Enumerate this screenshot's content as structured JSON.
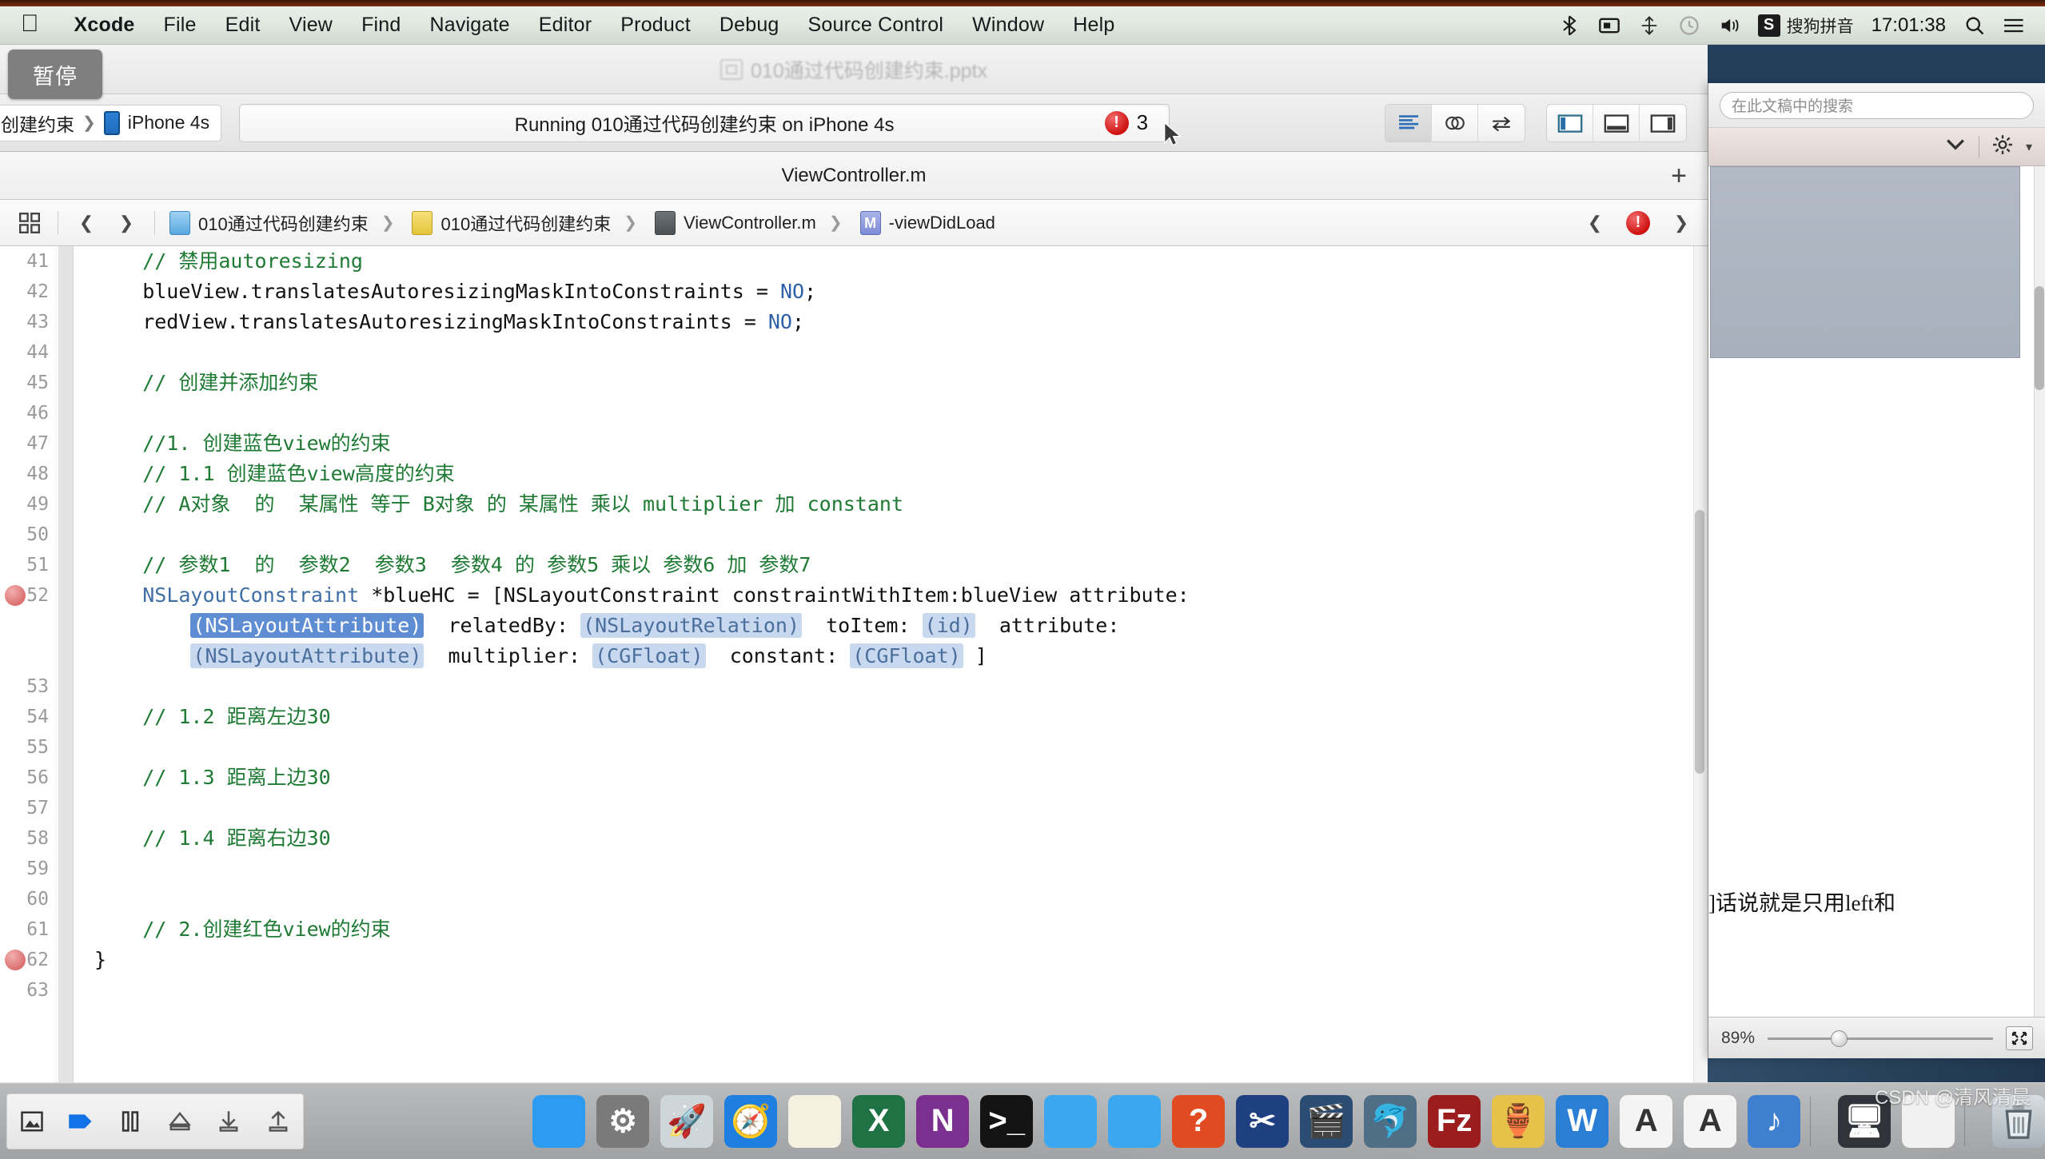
{
  "menubar": {
    "apple_icon": "apple-logo",
    "items": [
      "Xcode",
      "File",
      "Edit",
      "View",
      "Find",
      "Navigate",
      "Editor",
      "Product",
      "Debug",
      "Source Control",
      "Window",
      "Help"
    ],
    "status_icons": [
      "bluetooth-icon",
      "screen-record-icon",
      "airplay-icon",
      "timemachine-icon",
      "volume-icon"
    ],
    "ime_badge": "S",
    "ime_label": "搜狗拼音",
    "clock": "17:01:38",
    "search_icon": "search-icon",
    "notification_icon": "notification-center-icon"
  },
  "tooltip": {
    "label": "暂停"
  },
  "xcode": {
    "window_title": "010通过代码创建约束.pptx",
    "toolbar": {
      "scheme_project": "创建约束",
      "scheme_device": "iPhone 4s",
      "status_text": "Running 010通过代码创建约束 on iPhone 4s",
      "issue_count": "3",
      "issue_icon": "error-stop-icon",
      "editor_buttons": [
        "standard-editor-icon",
        "assistant-editor-icon",
        "version-editor-icon"
      ],
      "view_buttons": [
        "toggle-navigator-icon",
        "toggle-debug-area-icon",
        "toggle-utilities-icon"
      ]
    },
    "tab_title": "ViewController.m",
    "add_tab_icon": "plus-icon",
    "jumpbar": {
      "related_files_icon": "related-files-icon",
      "back_icon": "chevron-left-icon",
      "forward_icon": "chevron-right-icon",
      "crumbs": [
        {
          "icon": "project-icon",
          "label": "010通过代码创建约束"
        },
        {
          "icon": "folder-icon",
          "label": "010通过代码创建约束"
        },
        {
          "icon": "source-file-icon",
          "label": "ViewController.m"
        },
        {
          "icon": "method-icon",
          "label": "-viewDidLoad"
        }
      ],
      "prev_issue_icon": "chevron-left-icon",
      "issue_icon": "error-stop-icon",
      "next_issue_icon": "chevron-right-icon"
    },
    "code": {
      "first_line_number": 41,
      "breakpoint_lines": [
        52,
        62
      ],
      "lines": [
        {
          "n": 41,
          "tokens": [
            {
              "t": "    // 禁用autoresizing",
              "c": "cmt"
            }
          ]
        },
        {
          "n": 42,
          "tokens": [
            {
              "t": "    blueView.translatesAutoresizingMaskIntoConstraints = ",
              "c": ""
            },
            {
              "t": "NO",
              "c": "type"
            },
            {
              "t": ";",
              "c": ""
            }
          ]
        },
        {
          "n": 43,
          "tokens": [
            {
              "t": "    redView.translatesAutoresizingMaskIntoConstraints = ",
              "c": ""
            },
            {
              "t": "NO",
              "c": "type"
            },
            {
              "t": ";",
              "c": ""
            }
          ]
        },
        {
          "n": 44,
          "tokens": [
            {
              "t": "",
              "c": ""
            }
          ]
        },
        {
          "n": 45,
          "tokens": [
            {
              "t": "    // 创建并添加约束",
              "c": "cmt"
            }
          ]
        },
        {
          "n": 46,
          "tokens": [
            {
              "t": "",
              "c": ""
            }
          ]
        },
        {
          "n": 47,
          "tokens": [
            {
              "t": "    //1. 创建蓝色view的约束",
              "c": "cmt"
            }
          ]
        },
        {
          "n": 48,
          "tokens": [
            {
              "t": "    // 1.1 创建蓝色view高度的约束",
              "c": "cmt"
            }
          ]
        },
        {
          "n": 49,
          "tokens": [
            {
              "t": "    // A对象  的  某属性 等于 B对象 的 某属性 乘以 multiplier 加 constant",
              "c": "cmt"
            }
          ]
        },
        {
          "n": 50,
          "tokens": [
            {
              "t": "",
              "c": ""
            }
          ]
        },
        {
          "n": 51,
          "tokens": [
            {
              "t": "    // 参数1  的  参数2  参数3  参数4 的 参数5 乘以 参数6 加 参数7",
              "c": "cmt"
            }
          ]
        },
        {
          "n": 52,
          "tokens": [
            {
              "t": "    ",
              "c": ""
            },
            {
              "t": "NSLayoutConstraint",
              "c": "cls"
            },
            {
              "t": " *blueHC = [",
              "c": ""
            },
            {
              "t": "NSLayoutConstraint",
              "c": ""
            },
            {
              "t": " constraintWithItem:blueView attribute:",
              "c": ""
            }
          ]
        },
        {
          "n": "",
          "tokens": [
            {
              "t": "        ",
              "c": ""
            },
            {
              "t": "(NSLayoutAttribute)",
              "c": "ph sel"
            },
            {
              "t": "  relatedBy: ",
              "c": ""
            },
            {
              "t": "(NSLayoutRelation)",
              "c": "ph"
            },
            {
              "t": "  toItem: ",
              "c": ""
            },
            {
              "t": "(id)",
              "c": "ph"
            },
            {
              "t": "  attribute:",
              "c": ""
            }
          ]
        },
        {
          "n": "",
          "tokens": [
            {
              "t": "        ",
              "c": ""
            },
            {
              "t": "(NSLayoutAttribute)",
              "c": "ph"
            },
            {
              "t": "  multiplier: ",
              "c": ""
            },
            {
              "t": "(CGFloat)",
              "c": "ph"
            },
            {
              "t": "  constant: ",
              "c": ""
            },
            {
              "t": "(CGFloat)",
              "c": "ph"
            },
            {
              "t": " ]",
              "c": ""
            }
          ]
        },
        {
          "n": 53,
          "tokens": [
            {
              "t": "",
              "c": ""
            }
          ]
        },
        {
          "n": 54,
          "tokens": [
            {
              "t": "    // 1.2 距离左边30",
              "c": "cmt"
            }
          ]
        },
        {
          "n": 55,
          "tokens": [
            {
              "t": "",
              "c": ""
            }
          ]
        },
        {
          "n": 56,
          "tokens": [
            {
              "t": "    // 1.3 距离上边30",
              "c": "cmt"
            }
          ]
        },
        {
          "n": 57,
          "tokens": [
            {
              "t": "",
              "c": ""
            }
          ]
        },
        {
          "n": 58,
          "tokens": [
            {
              "t": "    // 1.4 距离右边30",
              "c": "cmt"
            }
          ]
        },
        {
          "n": 59,
          "tokens": [
            {
              "t": "",
              "c": ""
            }
          ]
        },
        {
          "n": 60,
          "tokens": [
            {
              "t": "",
              "c": ""
            }
          ]
        },
        {
          "n": 61,
          "tokens": [
            {
              "t": "    // 2.创建红色view的约束",
              "c": "cmt"
            }
          ]
        },
        {
          "n": 62,
          "tokens": [
            {
              "t": "}",
              "c": ""
            }
          ]
        },
        {
          "n": 63,
          "tokens": [
            {
              "t": "",
              "c": ""
            }
          ]
        }
      ]
    }
  },
  "word_window": {
    "search_placeholder": "在此文稿中的搜索",
    "collapse_icon": "chevron-down-icon",
    "gear_icon": "gear-icon",
    "body_text": "]话说就是只用left和",
    "zoom_value": "89%",
    "fit_icon": "fit-page-icon"
  },
  "dock": {
    "media_controls": [
      "screenshot-icon",
      "tag-icon",
      "pause-icon",
      "eject-icon",
      "download-icon",
      "upload-icon"
    ],
    "apps": [
      {
        "name": "finder-icon",
        "glyph": "",
        "bg": "#2d9bef"
      },
      {
        "name": "system-preferences-icon",
        "glyph": "⚙",
        "bg": "#7a7a7a"
      },
      {
        "name": "launchpad-icon",
        "glyph": "🚀",
        "bg": "#cfd6da"
      },
      {
        "name": "safari-icon",
        "glyph": "🧭",
        "bg": "#1f7fe0"
      },
      {
        "name": "notes-icon",
        "glyph": "",
        "bg": "#f5f1e0"
      },
      {
        "name": "excel-icon",
        "glyph": "X",
        "bg": "#1f7244"
      },
      {
        "name": "onenote-icon",
        "glyph": "N",
        "bg": "#7b2f8e"
      },
      {
        "name": "terminal-icon",
        "glyph": ">_",
        "bg": "#141414"
      },
      {
        "name": "xcode-icon",
        "glyph": "",
        "bg": "#3aa7f0"
      },
      {
        "name": "simulator-icon",
        "glyph": "",
        "bg": "#3aa7f0"
      },
      {
        "name": "preview-icon",
        "glyph": "?",
        "bg": "#e14b22"
      },
      {
        "name": "snipaste-icon",
        "glyph": "✂",
        "bg": "#1e3f80"
      },
      {
        "name": "quicktime-icon",
        "glyph": "🎬",
        "bg": "#2b4d73"
      },
      {
        "name": "navicat-icon",
        "glyph": "🐬",
        "bg": "#4f6f86"
      },
      {
        "name": "filezilla-icon",
        "glyph": "Fz",
        "bg": "#9b1d1d"
      },
      {
        "name": "charles-icon",
        "glyph": "🏺",
        "bg": "#e7c24a"
      },
      {
        "name": "word-icon",
        "glyph": "W",
        "bg": "#2a7fd4"
      },
      {
        "name": "textedit-a-icon",
        "glyph": "A",
        "bg": "#f4f4f4"
      },
      {
        "name": "font-book-icon",
        "glyph": "A",
        "bg": "#f4f4f4"
      },
      {
        "name": "itunes-icon",
        "glyph": "♪",
        "bg": "#3f7fd0"
      }
    ],
    "recent": [
      {
        "name": "screen-sharing-icon",
        "glyph": "🖥",
        "bg": "#30343a"
      },
      {
        "name": "document-stack-icon",
        "glyph": "",
        "bg": "#f1f1f1"
      }
    ],
    "trash_icon": "trash-icon"
  },
  "watermark": {
    "text": "CSDN @清风清晨"
  }
}
